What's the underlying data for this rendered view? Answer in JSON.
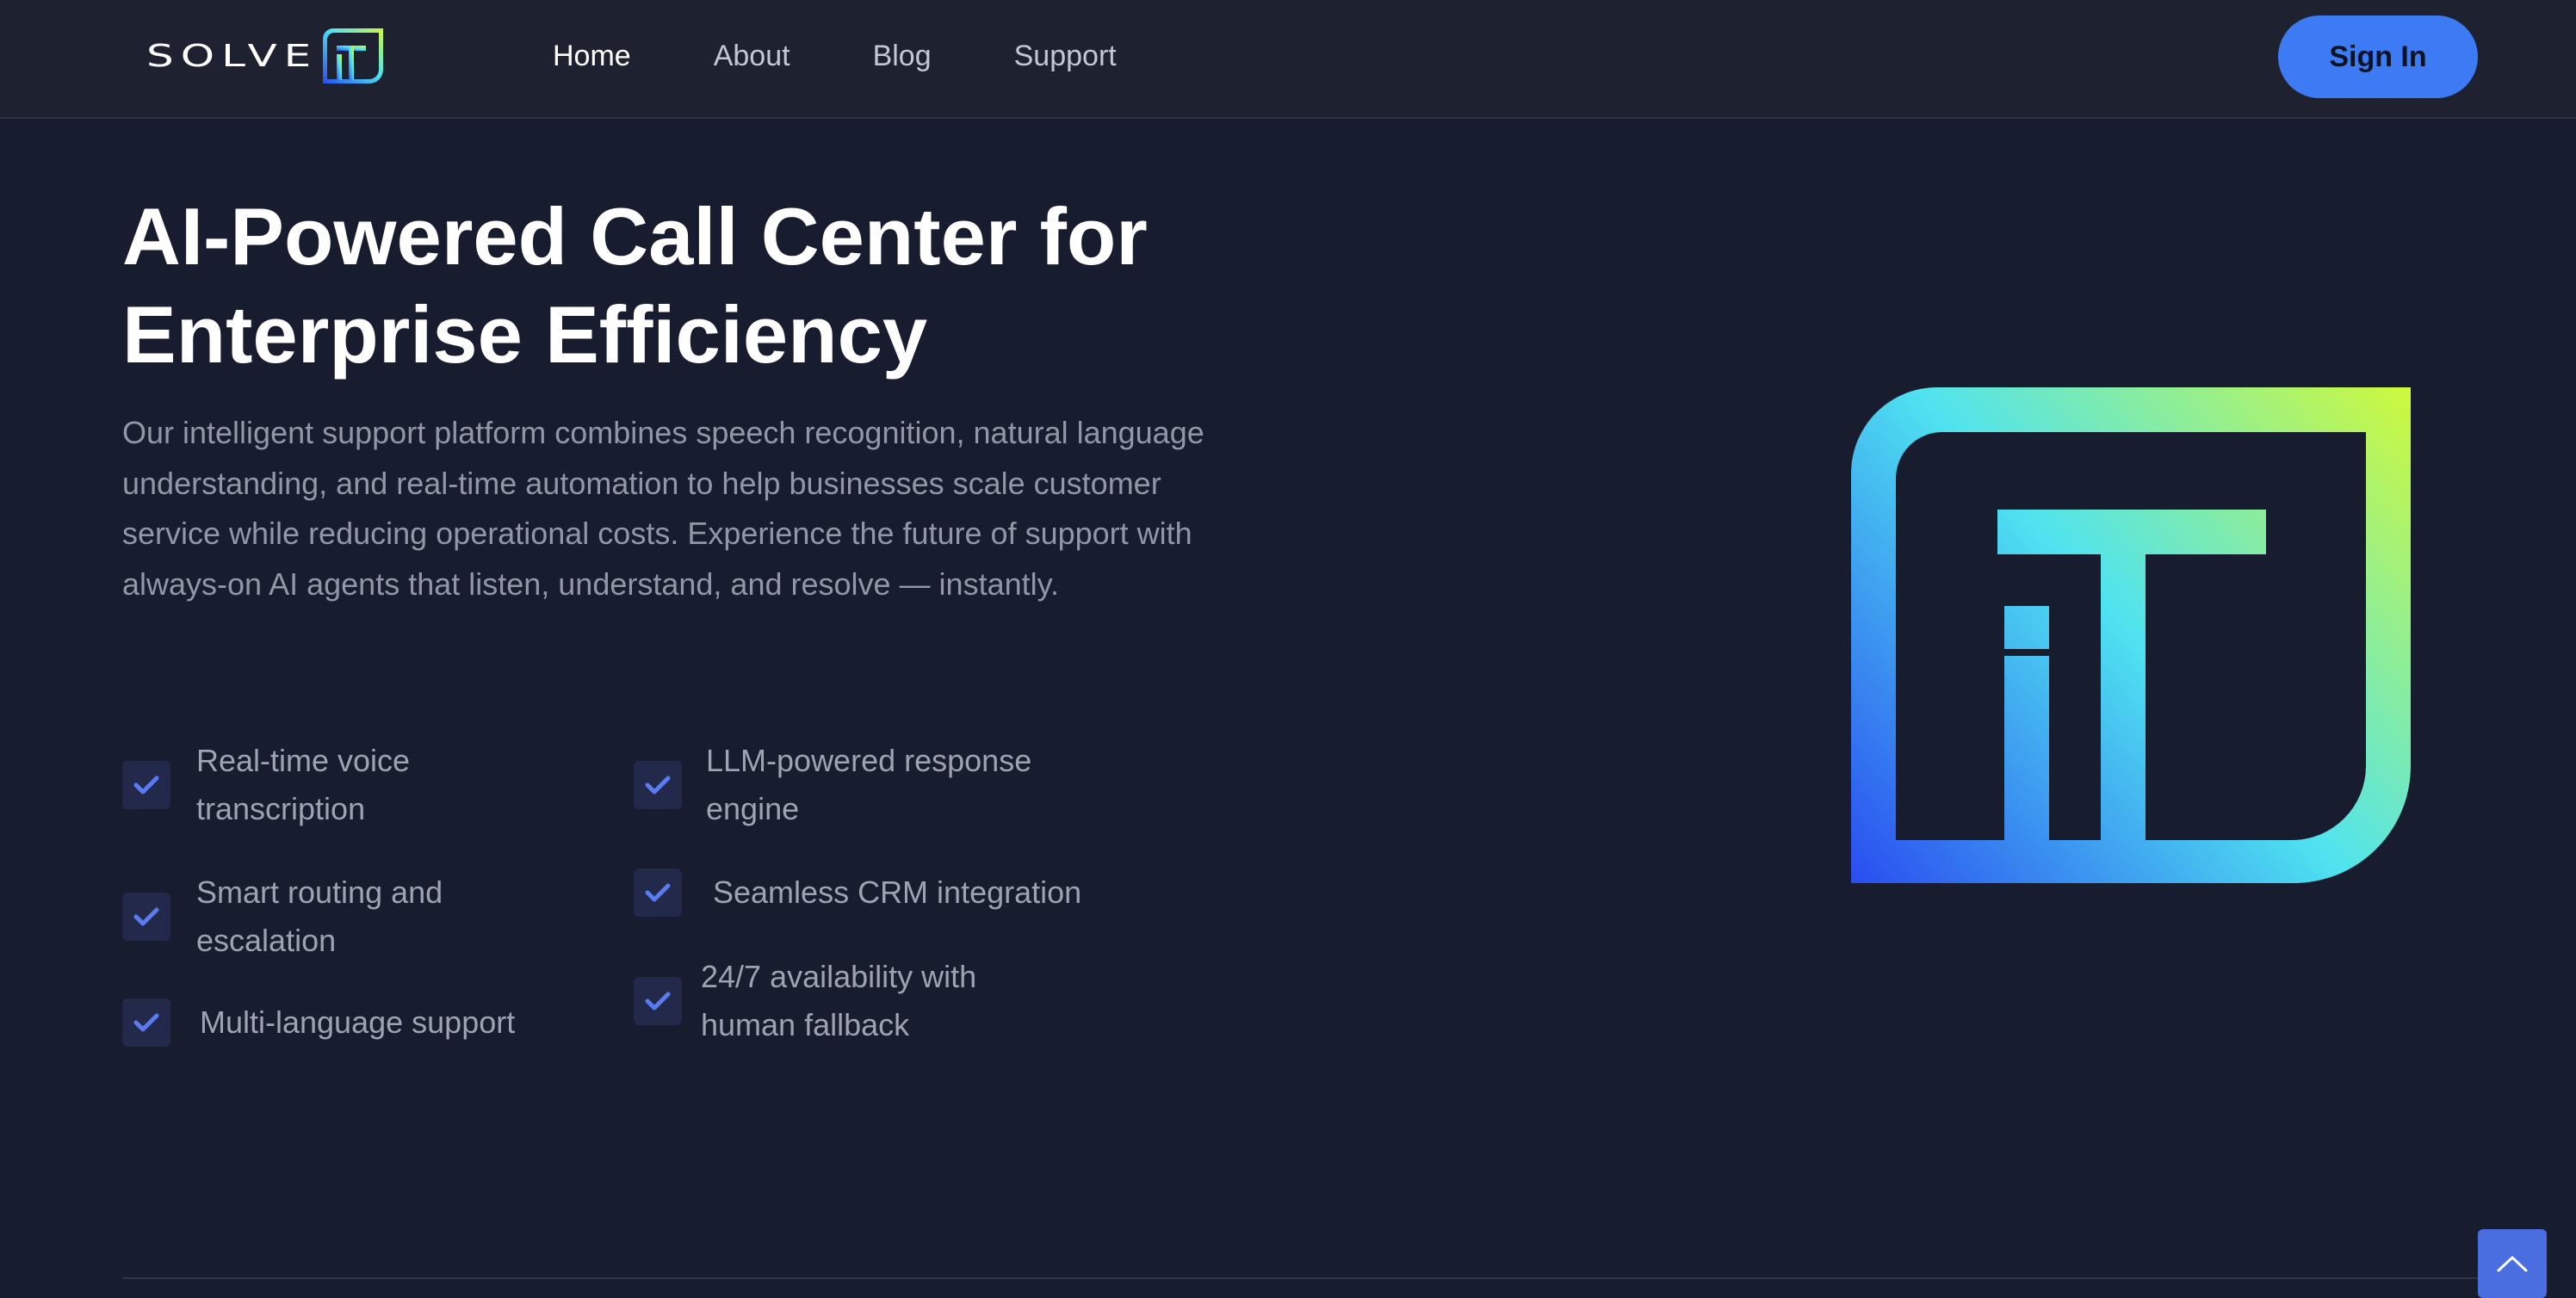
{
  "brand": {
    "logo_text": "SOLVE",
    "logo_mark": "iT"
  },
  "nav": {
    "links": [
      "Home",
      "About",
      "Blog",
      "Support"
    ],
    "active": "Home",
    "signin_label": "Sign In"
  },
  "hero": {
    "title_line1": "AI-Powered Call Center for",
    "title_line2": "Enterprise Efficiency",
    "description": "Our intelligent support platform combines speech recognition, natural language understanding, and real-time automation to help businesses scale customer service while reducing operational costs. Experience the future of support with always-on AI agents that listen, understand, and resolve — instantly."
  },
  "features": {
    "left": [
      {
        "line1": "Real-time voice",
        "line2": "transcription"
      },
      {
        "line1": "Smart routing and",
        "line2": "escalation"
      },
      {
        "line1": "Multi-language support",
        "line2": ""
      }
    ],
    "right": [
      {
        "line1": "LLM-powered response",
        "line2": "engine"
      },
      {
        "line1": "Seamless CRM integration",
        "line2": ""
      },
      {
        "line1": "24/7 availability with",
        "line2": "human fallback"
      }
    ]
  },
  "icons": {
    "check": "check-icon",
    "scroll_top": "chevron-up-icon",
    "hero_logo": "solveit-logo-mark"
  },
  "colors": {
    "background": "#171c2e",
    "navbar": "#1e2230",
    "accent": "#3d7bf4",
    "check": "#5b7cf0",
    "gradient_start": "#2a4cf0",
    "gradient_mid": "#4fe3f0",
    "gradient_end": "#d0f93a"
  }
}
